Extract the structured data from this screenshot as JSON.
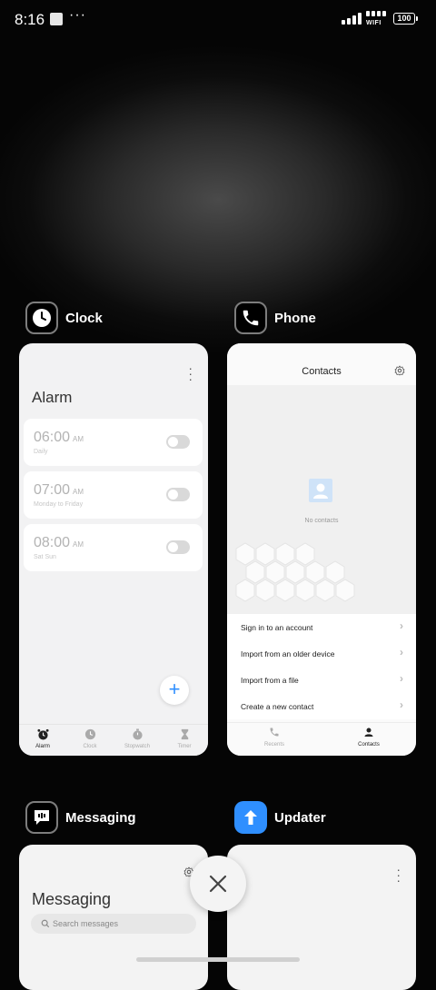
{
  "status_bar": {
    "time": "8:16",
    "dots": "···",
    "wifi_label": "WIFI",
    "battery": "100"
  },
  "apps": {
    "clock": {
      "label": "Clock",
      "screen_title": "Alarm",
      "alarms": [
        {
          "time": "06:00",
          "ampm": "AM",
          "repeat": "Daily"
        },
        {
          "time": "07:00",
          "ampm": "AM",
          "repeat": "Monday to Friday"
        },
        {
          "time": "08:00",
          "ampm": "AM",
          "repeat": "Sat Sun"
        }
      ],
      "fab": "+",
      "nav": [
        "Alarm",
        "Clock",
        "Stopwatch",
        "Timer"
      ]
    },
    "phone": {
      "label": "Phone",
      "screen_title": "Contacts",
      "empty_text": "No contacts",
      "actions": [
        "Sign in to an account",
        "Import from an older device",
        "Import from a file",
        "Create a new contact"
      ],
      "chevron": "›",
      "nav": [
        "Recents",
        "Contacts"
      ]
    },
    "messaging": {
      "label": "Messaging",
      "screen_title": "Messaging",
      "search_placeholder": "Search messages"
    },
    "updater": {
      "label": "Updater"
    }
  },
  "colors": {
    "accent": "#2f8fff",
    "card_bg": "#f3f3f3"
  }
}
